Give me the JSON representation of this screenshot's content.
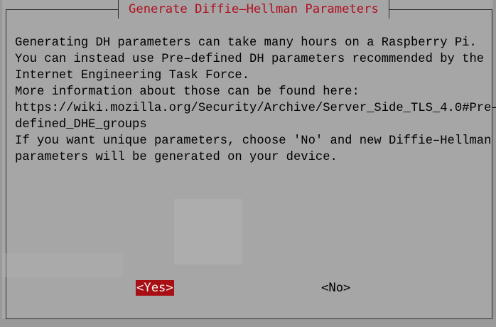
{
  "dialog": {
    "title": "Generate Diffie–Hellman Parameters",
    "message_lines": [
      "Generating DH parameters can take many hours on a Raspberry Pi.",
      "You can instead use Pre–defined DH parameters recommended by the",
      "Internet Engineering Task Force.",
      "More information about those can be found here:",
      "https://wiki.mozilla.org/Security/Archive/Server_Side_TLS_4.0#Pre–",
      "defined_DHE_groups",
      "If you want unique parameters, choose 'No' and new Diffie–Hellman",
      "parameters will be generated on your device."
    ]
  },
  "buttons": {
    "yes_label": "<Yes>",
    "no_label": "<No>",
    "selected": "yes"
  },
  "colors": {
    "dialog_bg": "#a6a6a6",
    "title_color": "#b01020",
    "selected_button_bg": "#a80f14",
    "selected_button_fg": "#f2f2f2"
  }
}
